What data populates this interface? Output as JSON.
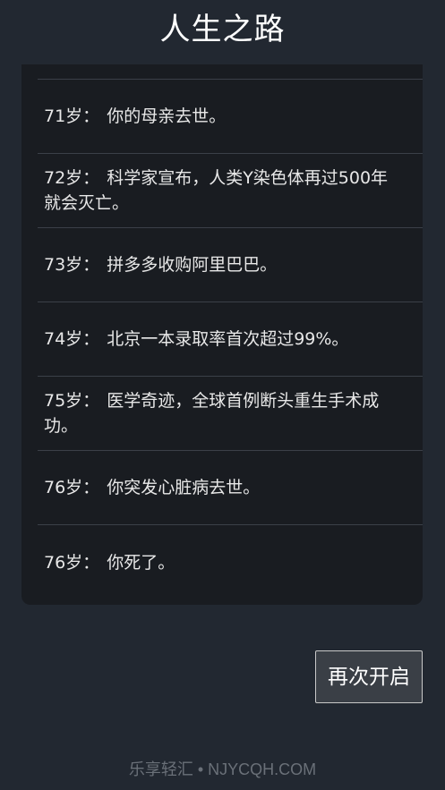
{
  "header": {
    "title": "人生之路"
  },
  "events": [
    {
      "age": "71岁：",
      "text": "你的母亲去世。"
    },
    {
      "age": "72岁：",
      "text": "科学家宣布，人类Y染色体再过500年就会灭亡。"
    },
    {
      "age": "73岁：",
      "text": "拼多多收购阿里巴巴。"
    },
    {
      "age": "74岁：",
      "text": "北京一本录取率首次超过99%。"
    },
    {
      "age": "75岁：",
      "text": "医学奇迹，全球首例断头重生手术成功。"
    },
    {
      "age": "76岁：",
      "text": "你突发心脏病去世。"
    },
    {
      "age": "76岁：",
      "text": "你死了。"
    }
  ],
  "actions": {
    "restart_label": "再次开启"
  },
  "footer": {
    "watermark": "乐享轻汇 • NJYCQH.COM"
  }
}
